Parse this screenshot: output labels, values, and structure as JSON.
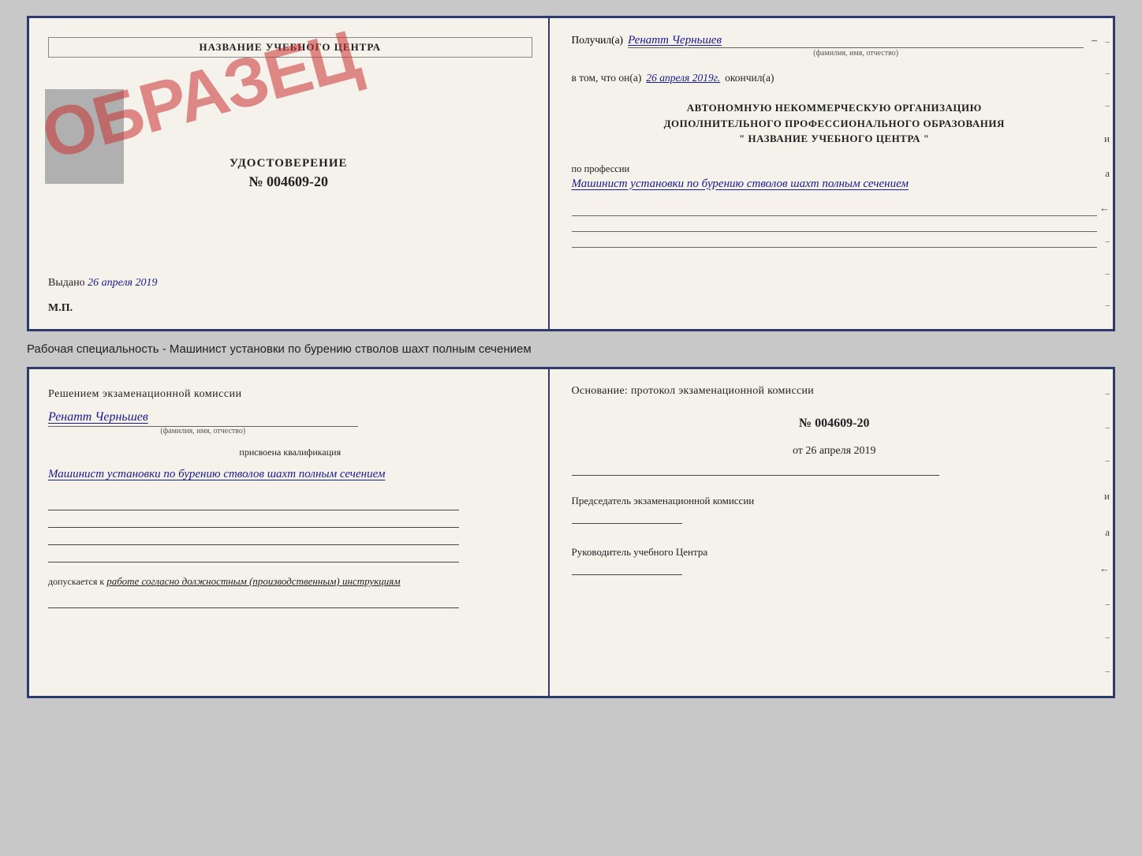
{
  "top_doc": {
    "left": {
      "title": "НАЗВАНИЕ УЧЕБНОГО ЦЕНТРА",
      "udost_label": "УДОСТОВЕРЕНИЕ",
      "number": "№ 004609-20",
      "vydano_label": "Выдано",
      "vydano_date": "26 апреля 2019",
      "mp_label": "М.П.",
      "obrazec": "ОБРАЗЕЦ"
    },
    "right": {
      "poluchil_label": "Получил(а)",
      "fio_value": "Ренатт Черньшев",
      "fio_hint": "(фамилия, имя, отчество)",
      "dash": "–",
      "vtom_label": "в том, что он(а)",
      "vtom_date": "26 апреля 2019г.",
      "okoncil_label": "окончил(а)",
      "org_line1": "АВТОНОМНУЮ НЕКОММЕРЧЕСКУЮ ОРГАНИЗАЦИЮ",
      "org_line2": "ДОПОЛНИТЕЛЬНОГО ПРОФЕССИОНАЛЬНОГО ОБРАЗОВАНИЯ",
      "org_name": "\" НАЗВАНИЕ УЧЕБНОГО ЦЕНТРА \"",
      "i_label": "и",
      "a_label": "а",
      "arrow_label": "←",
      "prof_label": "по профессии",
      "prof_value": "Машинист установки по бурению стволов шахт полным сечением"
    }
  },
  "middle_text": "Рабочая специальность - Машинист установки по бурению стволов шахт полным сечением",
  "bottom_doc": {
    "left": {
      "reshen_title": "Решением экзаменационной комиссии",
      "fio_value": "Ренатт Черньшев",
      "fio_hint": "(фамилия, имя, отчество)",
      "prisv_label": "присвоена квалификация",
      "kvali_value": "Машинист установки по бурению стволов шахт полным сечением",
      "dopusk_label": "допускается к",
      "dopusk_value": "работе согласно должностным (производственным) инструкциям"
    },
    "right": {
      "osnov_title": "Основание: протокол экзаменационной комиссии",
      "number": "№ 004609-20",
      "date_prefix": "от",
      "date": "26 апреля 2019",
      "predsed_label": "Председатель экзаменационной комиссии",
      "ruk_label": "Руководитель учебного Центра"
    }
  },
  "side_items": [
    "–",
    "–",
    "–",
    "и",
    "а",
    "←",
    "–",
    "–",
    "–"
  ],
  "bottom_side_items": [
    "–",
    "–",
    "–",
    "и",
    "а",
    "←",
    "–",
    "–",
    "–"
  ]
}
